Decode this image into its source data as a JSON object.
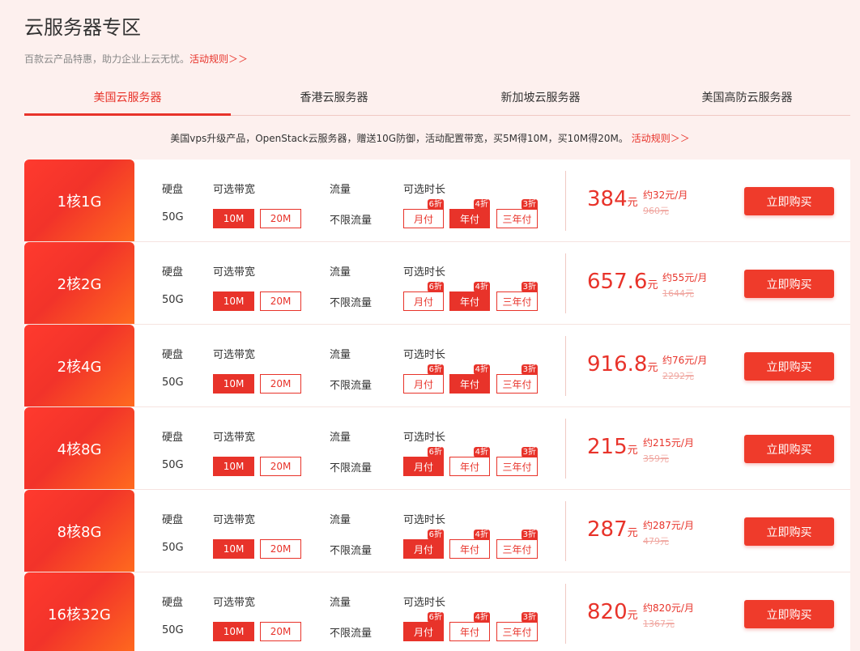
{
  "header": {
    "title": "云服务器专区",
    "subtitle": "百款云产品特惠，助力企业上云无忧。",
    "rules_link": "活动规则＞＞"
  },
  "tabs": [
    {
      "label": "美国云服务器",
      "active": true
    },
    {
      "label": "香港云服务器",
      "active": false
    },
    {
      "label": "新加坡云服务器",
      "active": false
    },
    {
      "label": "美国高防云服务器",
      "active": false
    }
  ],
  "notice": {
    "text": "美国vps升级产品，OpenStack云服务器，赠送10G防御，活动配置带宽，买5M得10M，买10M得20M。",
    "link": "活动规则＞＞"
  },
  "labels": {
    "disk": "硬盘",
    "bandwidth": "可选带宽",
    "traffic": "流量",
    "duration": "可选时长",
    "buy": "立即购买"
  },
  "colors": {
    "accent": "#e8332a",
    "page_bg": "#fdf0ee"
  },
  "rows": [
    {
      "spec": "1核1G",
      "disk": "50G",
      "bw": [
        "10M",
        "20M"
      ],
      "bw_sel": 0,
      "traffic": "不限流量",
      "dur": [
        "月付",
        "年付",
        "三年付"
      ],
      "disc": [
        "6折",
        "4折",
        "3折"
      ],
      "dur_sel": 1,
      "price": "384",
      "unit": "元",
      "monthly": "约32元/月",
      "original": "960元"
    },
    {
      "spec": "2核2G",
      "disk": "50G",
      "bw": [
        "10M",
        "20M"
      ],
      "bw_sel": 0,
      "traffic": "不限流量",
      "dur": [
        "月付",
        "年付",
        "三年付"
      ],
      "disc": [
        "6折",
        "4折",
        "3折"
      ],
      "dur_sel": 1,
      "price": "657.6",
      "unit": "元",
      "monthly": "约55元/月",
      "original": "1644元"
    },
    {
      "spec": "2核4G",
      "disk": "50G",
      "bw": [
        "10M",
        "20M"
      ],
      "bw_sel": 0,
      "traffic": "不限流量",
      "dur": [
        "月付",
        "年付",
        "三年付"
      ],
      "disc": [
        "6折",
        "4折",
        "3折"
      ],
      "dur_sel": 1,
      "price": "916.8",
      "unit": "元",
      "monthly": "约76元/月",
      "original": "2292元"
    },
    {
      "spec": "4核8G",
      "disk": "50G",
      "bw": [
        "10M",
        "20M"
      ],
      "bw_sel": 0,
      "traffic": "不限流量",
      "dur": [
        "月付",
        "年付",
        "三年付"
      ],
      "disc": [
        "6折",
        "4折",
        "3折"
      ],
      "dur_sel": 0,
      "price": "215",
      "unit": "元",
      "monthly": "约215元/月",
      "original": "359元"
    },
    {
      "spec": "8核8G",
      "disk": "50G",
      "bw": [
        "10M",
        "20M"
      ],
      "bw_sel": 0,
      "traffic": "不限流量",
      "dur": [
        "月付",
        "年付",
        "三年付"
      ],
      "disc": [
        "6折",
        "4折",
        "3折"
      ],
      "dur_sel": 0,
      "price": "287",
      "unit": "元",
      "monthly": "约287元/月",
      "original": "479元"
    },
    {
      "spec": "16核32G",
      "disk": "50G",
      "bw": [
        "10M",
        "20M"
      ],
      "bw_sel": 0,
      "traffic": "不限流量",
      "dur": [
        "月付",
        "年付",
        "三年付"
      ],
      "disc": [
        "6折",
        "4折",
        "3折"
      ],
      "dur_sel": 0,
      "price": "820",
      "unit": "元",
      "monthly": "约820元/月",
      "original": "1367元"
    }
  ]
}
